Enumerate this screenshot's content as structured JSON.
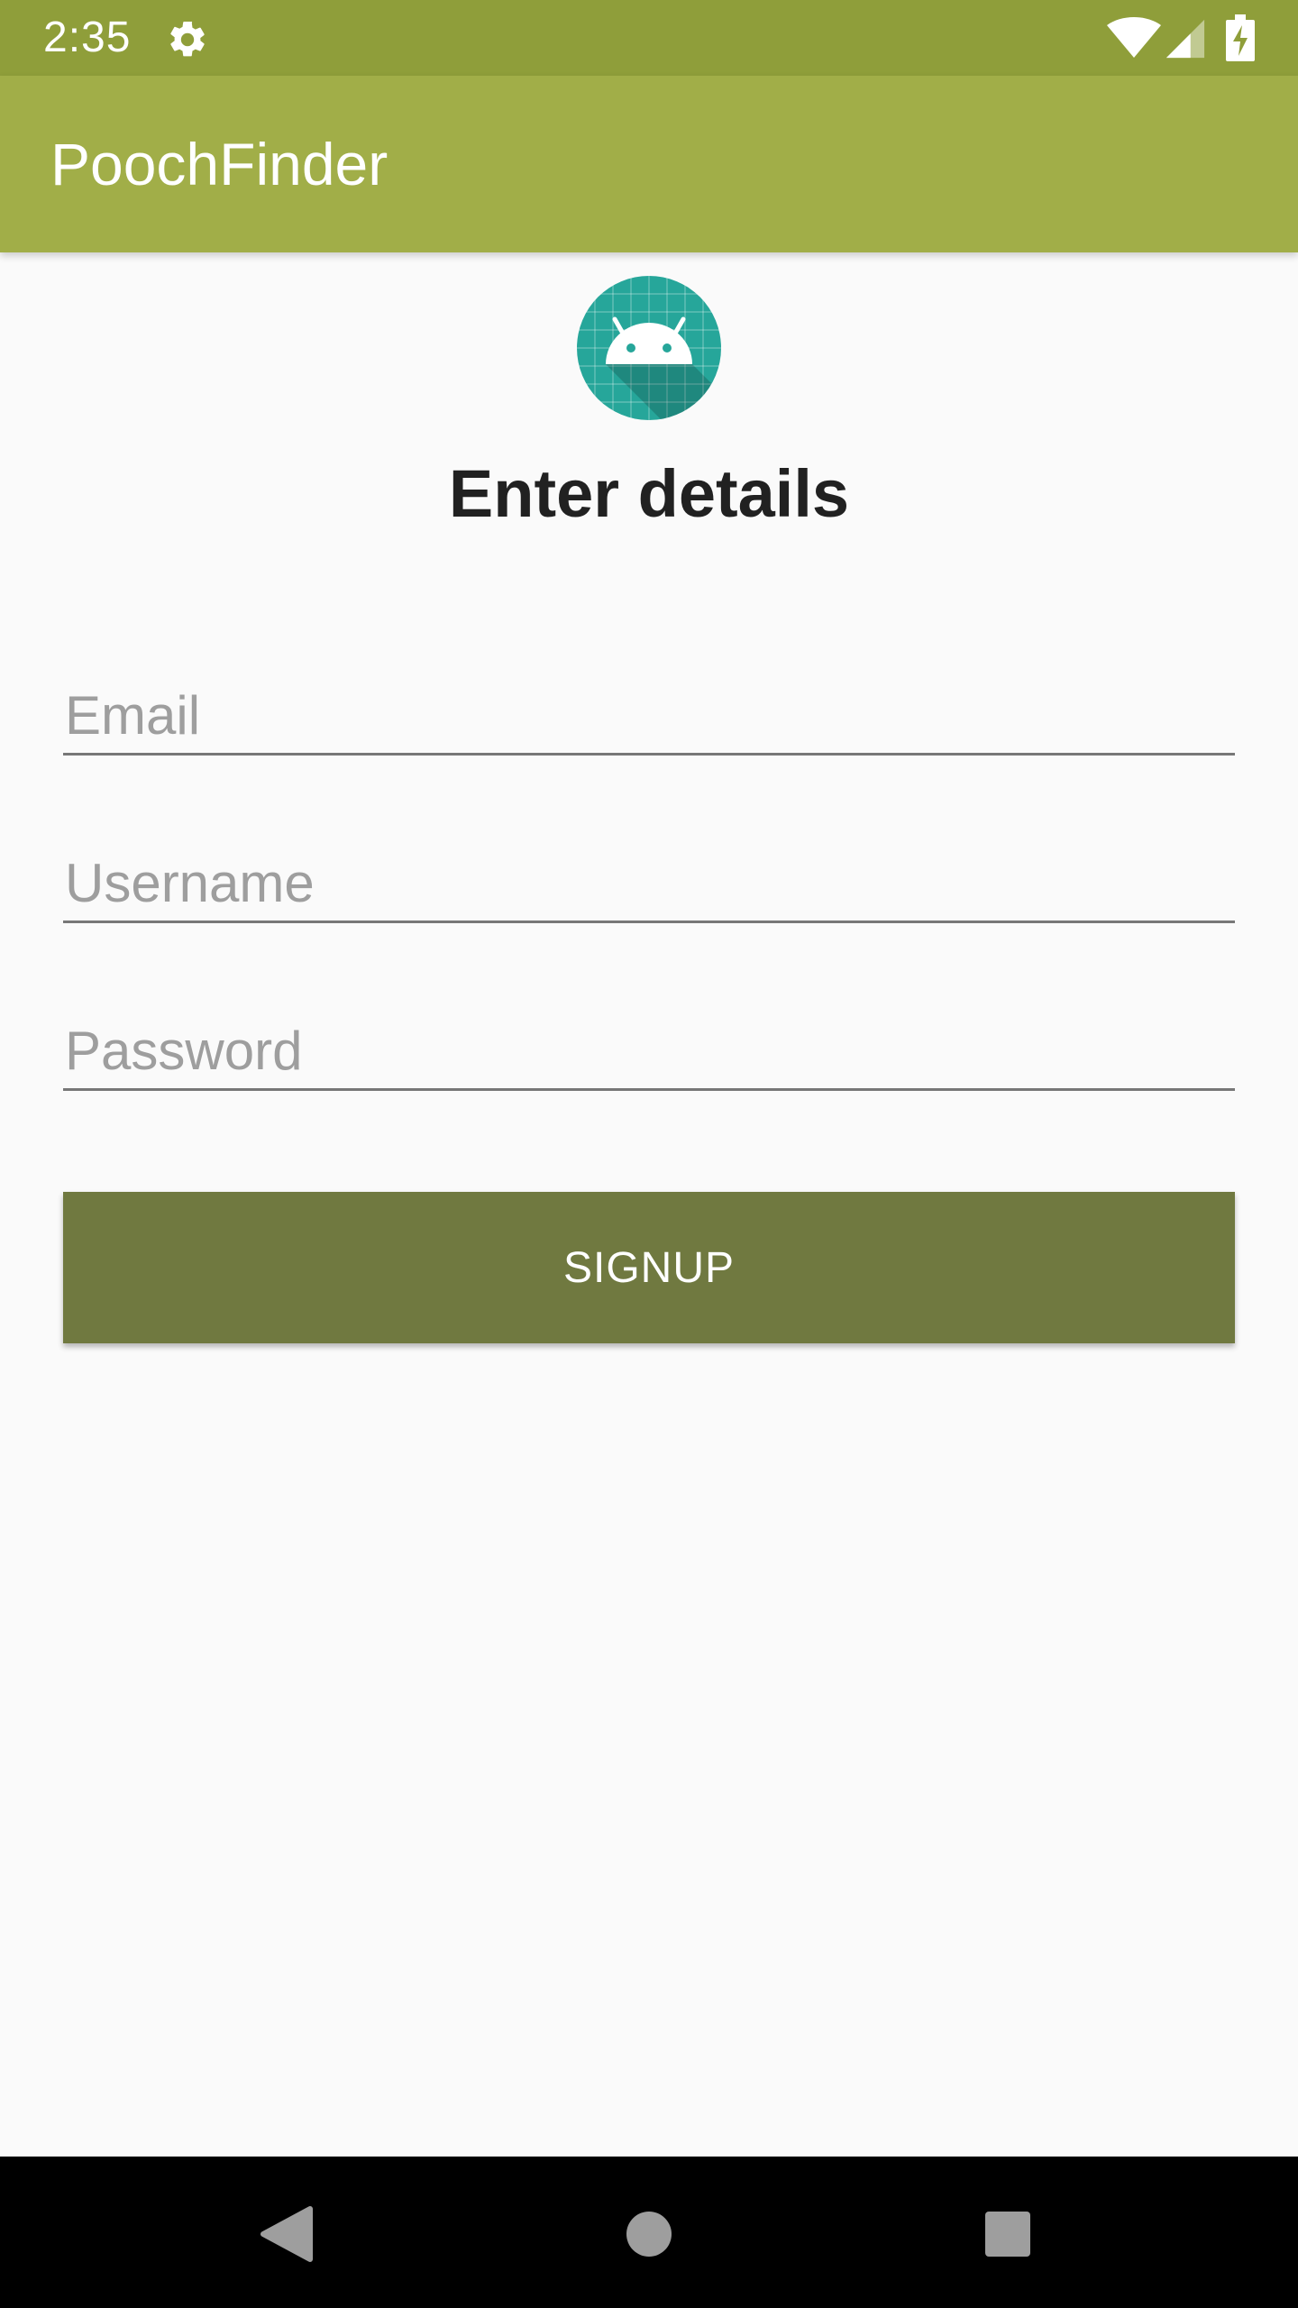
{
  "status_bar": {
    "time": "2:35",
    "icons": [
      "settings-gear-icon",
      "wifi-icon",
      "cell-signal-icon",
      "battery-charging-icon"
    ]
  },
  "app_bar": {
    "title": "PoochFinder",
    "color": "#a1ae48"
  },
  "logo": {
    "icon": "android-logo-icon"
  },
  "form": {
    "heading": "Enter details",
    "email_placeholder": "Email",
    "username_placeholder": "Username",
    "password_placeholder": "Password",
    "signup_label": "SIGNUP",
    "button_color": "#707940"
  },
  "nav_bar": {
    "icons": [
      "back-icon",
      "home-icon",
      "recents-icon"
    ]
  }
}
